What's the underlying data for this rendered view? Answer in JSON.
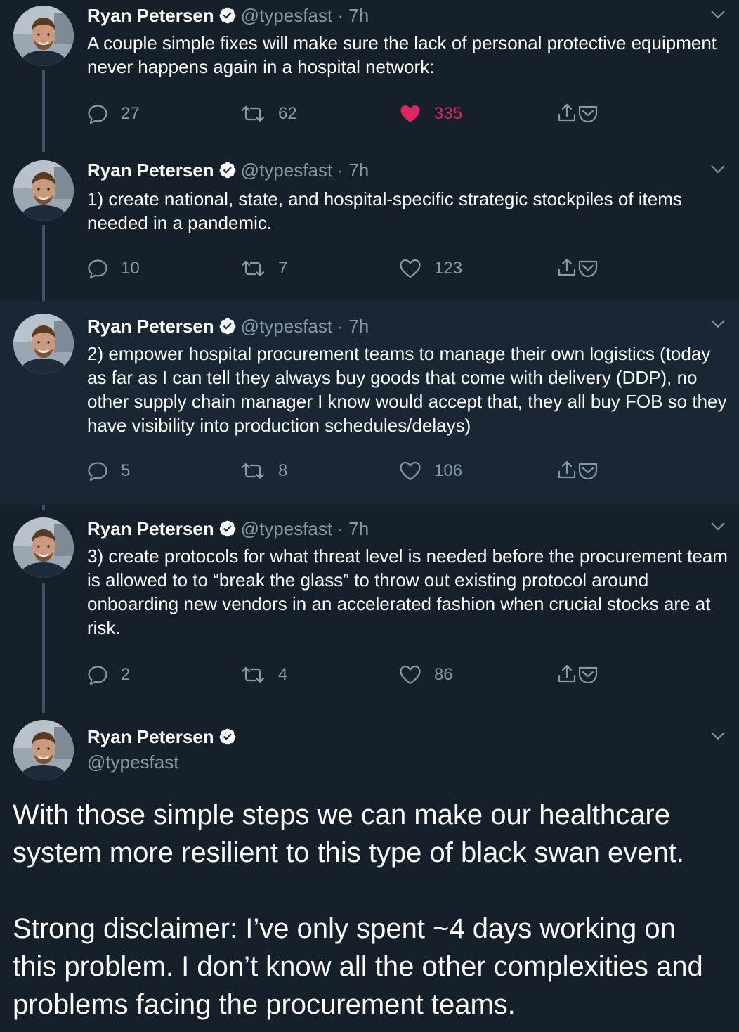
{
  "tweets": [
    {
      "name": "Ryan Petersen",
      "handle": "@typesfast",
      "time": "7h",
      "text": "A couple simple fixes will make sure the lack of personal protective equipment never happens again in a hospital network:",
      "replies": "27",
      "retweets": "62",
      "likes": "335",
      "liked": true
    },
    {
      "name": "Ryan Petersen",
      "handle": "@typesfast",
      "time": "7h",
      "text": "1) create national, state, and hospital-specific strategic stockpiles of items needed in a pandemic.",
      "replies": "10",
      "retweets": "7",
      "likes": "123",
      "liked": false
    },
    {
      "name": "Ryan Petersen",
      "handle": "@typesfast",
      "time": "7h",
      "text": "2) empower hospital procurement teams to manage their own logistics (today as far as I can tell they always buy goods that come with delivery (DDP), no other supply chain manager I know would accept that, they all buy FOB so they have visibility into production schedules/delays)",
      "replies": "5",
      "retweets": "8",
      "likes": "106",
      "liked": false
    },
    {
      "name": "Ryan Petersen",
      "handle": "@typesfast",
      "time": "7h",
      "text": "3) create protocols for what threat level is needed before the procurement team is allowed to to “break the glass” to throw out existing protocol around onboarding new vendors in an accelerated fashion when crucial stocks are at risk.",
      "replies": "2",
      "retweets": "4",
      "likes": "86",
      "liked": false
    }
  ],
  "main_tweet": {
    "name": "Ryan Petersen",
    "handle": "@typesfast",
    "paragraph1": "With those simple steps we can make our healthcare system more resilient to this type of black swan event.",
    "paragraph2": "Strong disclaimer: I’ve only spent ~4 days working on this problem. I don’t know all the other complexities and problems facing the procurement teams."
  },
  "separator": "·",
  "colors": {
    "background": "#15202b",
    "highlight_background": "#192734",
    "muted": "#8899a6",
    "like": "#e0245e",
    "verified": "#ffffff",
    "thread_line": "#3d5466"
  },
  "icons": [
    "verified-badge-icon",
    "chevron-down-icon",
    "reply-icon",
    "retweet-icon",
    "like-icon",
    "share-icon",
    "dm-icon"
  ]
}
